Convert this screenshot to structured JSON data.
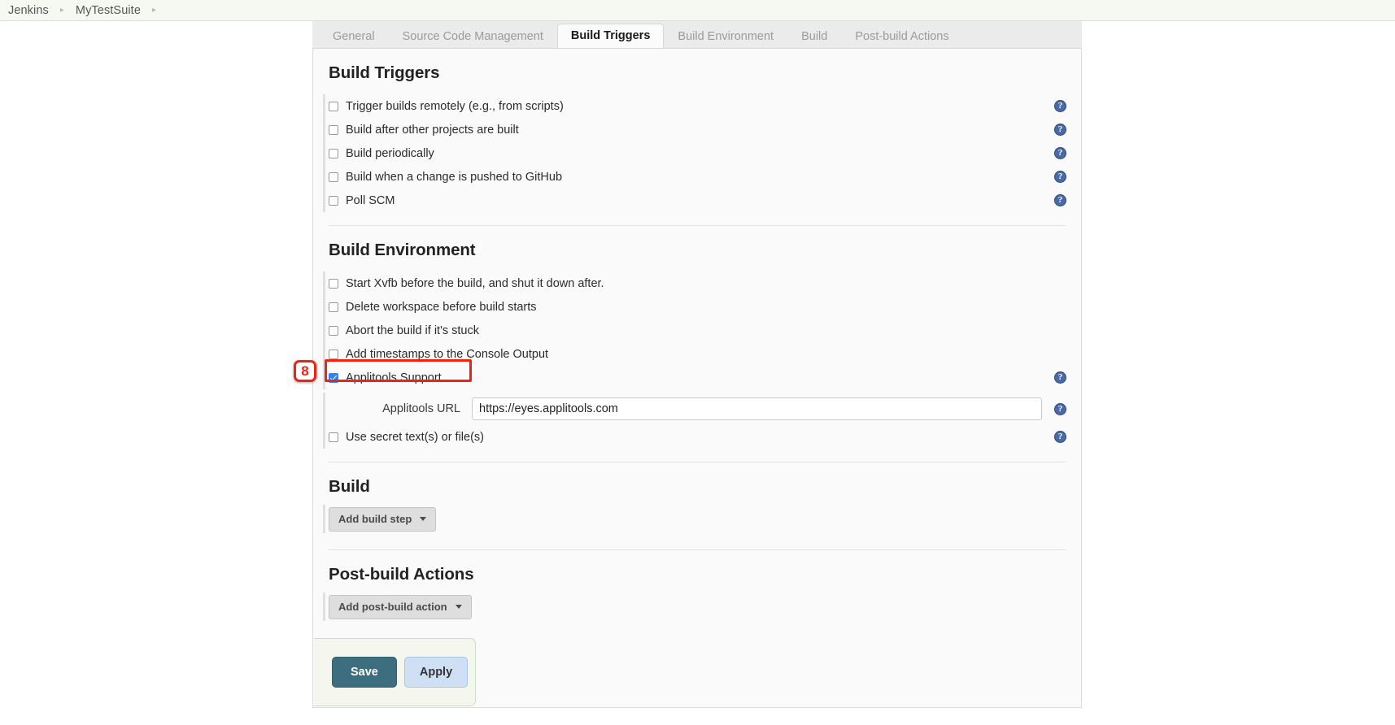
{
  "breadcrumb": {
    "items": [
      "Jenkins",
      "MyTestSuite"
    ],
    "separator": "▸"
  },
  "tabs": [
    {
      "label": "General",
      "active": false
    },
    {
      "label": "Source Code Management",
      "active": false
    },
    {
      "label": "Build Triggers",
      "active": true
    },
    {
      "label": "Build Environment",
      "active": false
    },
    {
      "label": "Build",
      "active": false
    },
    {
      "label": "Post-build Actions",
      "active": false
    }
  ],
  "build_triggers": {
    "title": "Build Triggers",
    "options": [
      {
        "label": "Trigger builds remotely (e.g., from scripts)",
        "checked": false,
        "help": "?"
      },
      {
        "label": "Build after other projects are built",
        "checked": false,
        "help": "?"
      },
      {
        "label": "Build periodically",
        "checked": false,
        "help": "?"
      },
      {
        "label": "Build when a change is pushed to GitHub",
        "checked": false,
        "help": "?"
      },
      {
        "label": "Poll SCM",
        "checked": false,
        "help": "?"
      }
    ]
  },
  "build_environment": {
    "title": "Build Environment",
    "options": [
      {
        "label": "Start Xvfb before the build, and shut it down after.",
        "checked": false,
        "help": ""
      },
      {
        "label": "Delete workspace before build starts",
        "checked": false,
        "help": ""
      },
      {
        "label": "Abort the build if it's stuck",
        "checked": false,
        "help": ""
      },
      {
        "label": "Add timestamps to the Console Output",
        "checked": false,
        "help": ""
      },
      {
        "label": "Applitools Support",
        "checked": true,
        "help": "?"
      }
    ],
    "applitools_url_label": "Applitools URL",
    "applitools_url_value": "https://eyes.applitools.com",
    "applitools_url_placeholder": "https://eyes.applitools.com",
    "applitools_url_help": "?",
    "secret_option": {
      "label": "Use secret text(s) or file(s)",
      "checked": false,
      "help": "?"
    }
  },
  "build": {
    "title": "Build",
    "add_button": "Add build step"
  },
  "post_build": {
    "title": "Post-build Actions",
    "add_button": "Add post-build action"
  },
  "footer": {
    "save_label": "Save",
    "apply_label": "Apply"
  },
  "annotation": {
    "step_number": "8",
    "color": "#f02311"
  },
  "colors": {
    "accent_checkbox": "#2b83f6",
    "help_icon": "#4a6aa5",
    "save_button": "#3c6e7f",
    "apply_button": "#cfe0f5",
    "breadcrumb_bg": "#f6f9f1",
    "panel_bg": "#fafafa"
  }
}
